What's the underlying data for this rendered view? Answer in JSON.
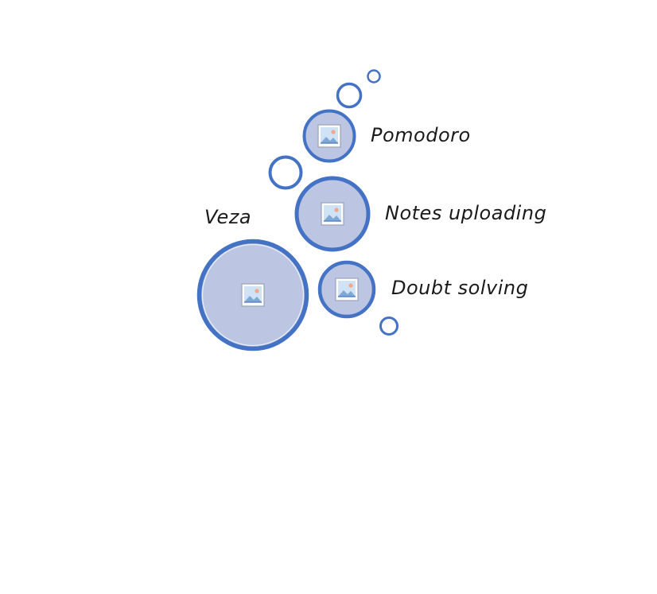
{
  "diagram": {
    "root": {
      "label": "Veza"
    },
    "features": [
      {
        "label": "Pomodoro",
        "icon": "image-placeholder-icon"
      },
      {
        "label": "Notes uploading",
        "icon": "image-placeholder-icon"
      },
      {
        "label": "Doubt solving",
        "icon": "image-placeholder-icon"
      }
    ],
    "root_icon": "image-placeholder-icon"
  },
  "colors": {
    "circle_fill": "#bcc5e2",
    "circle_stroke": "#4472c4",
    "bubble_fill": "#ffffff",
    "icon_sky": "#cfe3f5",
    "icon_hill": "#7fa7d8",
    "icon_sun": "#f4a58a",
    "text": "#1a1a1a"
  }
}
